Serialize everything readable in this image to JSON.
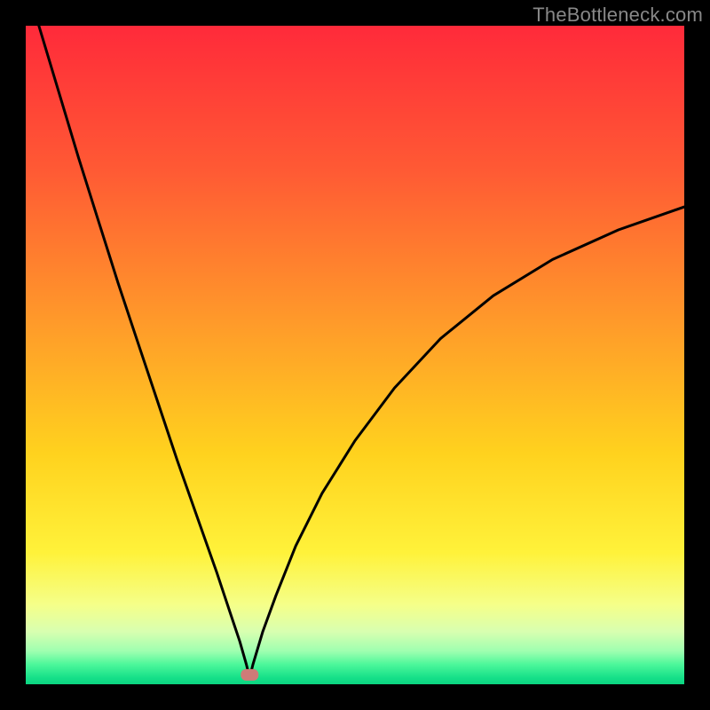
{
  "watermark": "TheBottleneck.com",
  "chart_data": {
    "type": "line",
    "title": "",
    "xlabel": "",
    "ylabel": "",
    "xlim": [
      0,
      100
    ],
    "ylim": [
      0,
      100
    ],
    "optimum_x": 34,
    "marker": {
      "x": 34,
      "y": 1.5,
      "color": "#cf7b78"
    },
    "series": [
      {
        "name": "bottleneck-curve",
        "x": [
          2,
          5,
          8,
          11,
          14,
          17,
          20,
          23,
          26,
          29,
          31,
          32.5,
          33.5,
          34,
          34.5,
          36,
          38,
          41,
          45,
          50,
          56,
          63,
          71,
          80,
          90,
          100
        ],
        "y": [
          100,
          90,
          80,
          70.5,
          61,
          52,
          43,
          34,
          25.5,
          17,
          11,
          6.5,
          3,
          1,
          3,
          8,
          13.5,
          21,
          29,
          37,
          45,
          52.5,
          59,
          64.5,
          69,
          72.5
        ]
      }
    ],
    "background_gradient": {
      "stops": [
        {
          "pct": 0,
          "color": "#ff2a3a"
        },
        {
          "pct": 22,
          "color": "#ff5a34"
        },
        {
          "pct": 45,
          "color": "#ff9a2a"
        },
        {
          "pct": 65,
          "color": "#ffd21e"
        },
        {
          "pct": 80,
          "color": "#fff23a"
        },
        {
          "pct": 88,
          "color": "#f5ff8a"
        },
        {
          "pct": 92,
          "color": "#d8ffb0"
        },
        {
          "pct": 95,
          "color": "#9effb0"
        },
        {
          "pct": 97,
          "color": "#4cf79a"
        },
        {
          "pct": 99,
          "color": "#16e089"
        },
        {
          "pct": 100,
          "color": "#0bd480"
        }
      ]
    }
  }
}
